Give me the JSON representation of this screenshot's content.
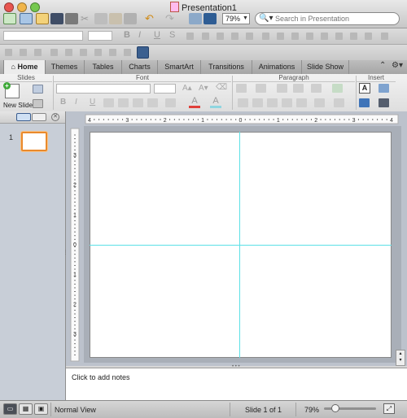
{
  "window": {
    "title": "Presentation1",
    "zoom_value": "79%"
  },
  "search": {
    "placeholder": "Search in Presentation"
  },
  "ribbon_tabs": [
    {
      "label": "Home",
      "active": true
    },
    {
      "label": "Themes"
    },
    {
      "label": "Tables"
    },
    {
      "label": "Charts"
    },
    {
      "label": "SmartArt"
    },
    {
      "label": "Transitions"
    },
    {
      "label": "Animations"
    },
    {
      "label": "Slide Show"
    }
  ],
  "ribbon_groups": {
    "slides": "Slides",
    "font": "Font",
    "paragraph": "Paragraph",
    "insert": "Insert"
  },
  "buttons": {
    "new_slide": "New Slide"
  },
  "format_glyphs": {
    "bold": "B",
    "italic": "I",
    "underline": "U",
    "shadow": "S"
  },
  "ruler": {
    "h_labels": [
      "4",
      "3",
      "2",
      "1",
      "0",
      "1",
      "2",
      "3",
      "4"
    ],
    "v_labels": [
      "3",
      "2",
      "1",
      "0",
      "1",
      "2",
      "3"
    ]
  },
  "thumbnails": [
    {
      "number": "1"
    }
  ],
  "notes": {
    "placeholder": "Click to add notes"
  },
  "status": {
    "view": "Normal View",
    "slide_count": "Slide 1 of 1",
    "zoom": "79%"
  },
  "colors": {
    "accent_thumb": "#ea8a2c",
    "guide": "#5ce0e6"
  }
}
